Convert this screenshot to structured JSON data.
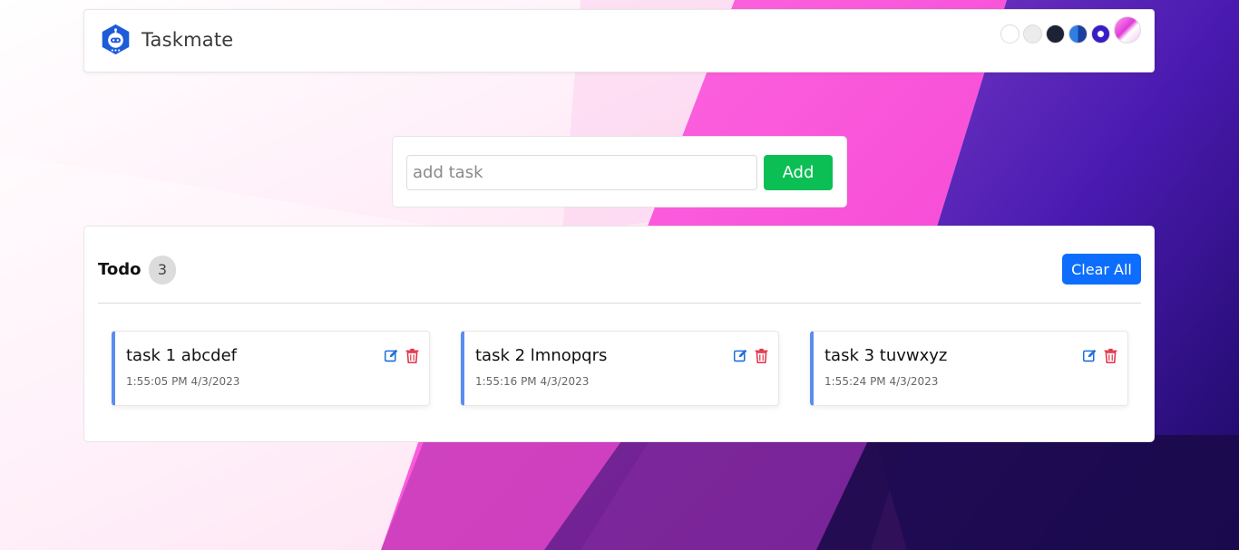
{
  "app": {
    "name": "Taskmate"
  },
  "themes": [
    {
      "name": "light",
      "color": "#ffffff"
    },
    {
      "name": "light-gray",
      "color": "#ececec"
    },
    {
      "name": "dark",
      "color": "#1e2235"
    },
    {
      "name": "blue",
      "color": "#2f7fe0"
    },
    {
      "name": "purple-x",
      "color": "#3a1cc7"
    },
    {
      "name": "pink-gradient",
      "color": "#e23ad8"
    }
  ],
  "add_task": {
    "placeholder": "add task",
    "button_label": "Add"
  },
  "todo": {
    "title": "Todo",
    "count": "3",
    "clear_label": "Clear All",
    "tasks": [
      {
        "title": "task 1 abcdef",
        "time": "1:55:05 PM 4/3/2023"
      },
      {
        "title": "task 2 lmnopqrs",
        "time": "1:55:16 PM 4/3/2023"
      },
      {
        "title": "task 3 tuvwxyz",
        "time": "1:55:24 PM 4/3/2023"
      }
    ]
  },
  "colors": {
    "add_button": "#0bbf55",
    "clear_button": "#0d6efd",
    "card_accent": "#5b8def",
    "edit_icon": "#1e6fd9",
    "delete_icon": "#e03145"
  }
}
